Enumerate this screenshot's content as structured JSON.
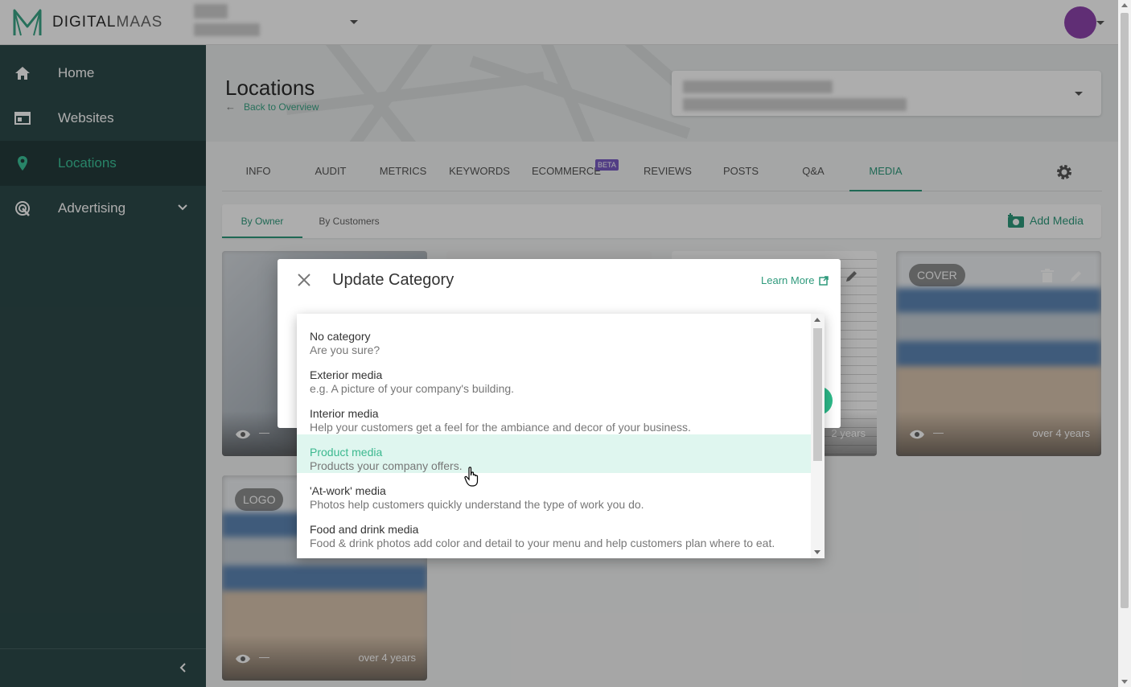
{
  "app": {
    "brand_bold": "DIGITAL",
    "brand_light": "MAAS"
  },
  "sidebar": {
    "items": [
      {
        "label": "Home",
        "icon": "home-icon"
      },
      {
        "label": "Websites",
        "icon": "websites-icon"
      },
      {
        "label": "Locations",
        "icon": "location-pin-icon",
        "active": true
      },
      {
        "label": "Advertising",
        "icon": "advertising-icon"
      }
    ]
  },
  "page": {
    "title": "Locations",
    "back_link": "Back to Overview"
  },
  "tabs": [
    {
      "label": "INFO"
    },
    {
      "label": "AUDIT"
    },
    {
      "label": "METRICS"
    },
    {
      "label": "KEYWORDS"
    },
    {
      "label": "ECOMMERCE",
      "badge": "BETA"
    },
    {
      "label": "REVIEWS"
    },
    {
      "label": "POSTS"
    },
    {
      "label": "Q&A"
    },
    {
      "label": "MEDIA",
      "active": true
    }
  ],
  "subtabs": [
    {
      "label": "By Owner",
      "active": true
    },
    {
      "label": "By Customers"
    }
  ],
  "add_media_label": "Add Media",
  "cards": [
    {
      "badge": "",
      "views": "—",
      "age": ""
    },
    {
      "badge": "",
      "views": "—",
      "age": ""
    },
    {
      "badge": "",
      "views": "—",
      "age": "2 years"
    },
    {
      "badge": "COVER",
      "views": "—",
      "age": "over 4 years"
    },
    {
      "badge": "LOGO",
      "views": "—",
      "age": "over 4 years"
    }
  ],
  "dialog": {
    "title": "Update Category",
    "learn_more": "Learn More"
  },
  "category_options": [
    {
      "title": "No category",
      "desc": "Are you sure?"
    },
    {
      "title": "Exterior media",
      "desc": "e.g. A picture of your company's building."
    },
    {
      "title": "Interior media",
      "desc": "Help your customers get a feel for the ambiance and decor of your business."
    },
    {
      "title": "Product media",
      "desc": "Products your company offers.",
      "highlighted": true
    },
    {
      "title": "'At-work' media",
      "desc": "Photos help customers quickly understand the type of work you do."
    },
    {
      "title": "Food and drink media",
      "desc": "Food & drink photos add color and detail to your menu and help customers plan where to eat."
    }
  ],
  "colors": {
    "accent": "#2f9a7c",
    "sidebar": "#2d4a4a",
    "highlight": "#dff6ef",
    "avatar": "#8e44ad",
    "beta": "#7a5cc4"
  }
}
